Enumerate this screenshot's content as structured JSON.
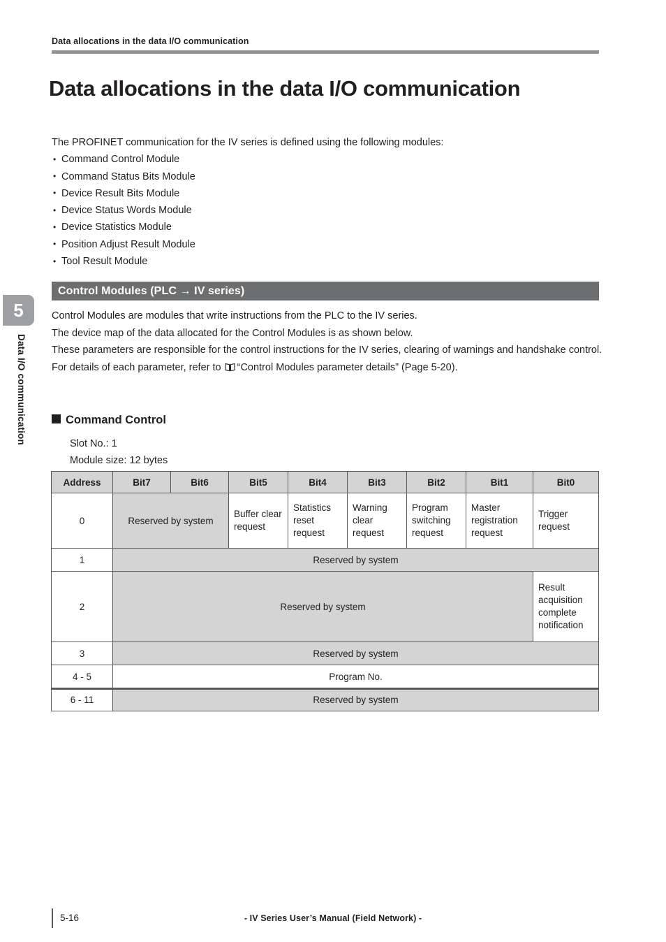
{
  "running_header": "Data allocations in the data I/O communication",
  "page_title": "Data allocations in the data I/O communication",
  "intro": {
    "lead": "The PROFINET communication for the IV series is defined using the following modules:",
    "bullets": [
      "Command Control Module",
      "Command Status Bits Module",
      "Device Result Bits Module",
      "Device Status Words Module",
      "Device Statistics Module",
      "Position Adjust Result Module",
      "Tool Result Module"
    ]
  },
  "section": {
    "band_title": "Control Modules (PLC → IV series)",
    "band_color": "#6d6e70",
    "paragraphs": [
      "Control Modules are modules that write instructions from the PLC to the IV series.",
      "The device map of the data allocated for the Control Modules is as shown below.",
      "These parameters are responsible for the control instructions for the IV series, clearing of warnings and handshake control."
    ],
    "reference": {
      "prefix": "For details of each parameter, refer to ",
      "icon": "book-icon",
      "text": "“Control Modules parameter details” (Page 5-20)."
    }
  },
  "subsection": {
    "title": "Command Control",
    "slot_no": "Slot No.: 1",
    "module_size": "Module size: 12 bytes"
  },
  "table": {
    "headers": [
      "Address",
      "Bit7",
      "Bit6",
      "Bit5",
      "Bit4",
      "Bit3",
      "Bit2",
      "Bit1",
      "Bit0"
    ],
    "rows": [
      {
        "address": "0",
        "cells": [
          "Reserved by system",
          "Buffer clear request",
          "Statistics reset request",
          "Warning clear request",
          "Program switching request",
          "Master registration request",
          "Trigger request"
        ]
      },
      {
        "address": "1",
        "cells": [
          "Reserved by system"
        ]
      },
      {
        "address": "2",
        "cells": [
          "Reserved by system",
          "Result acquisition complete notification"
        ]
      },
      {
        "address": "3",
        "cells": [
          "Reserved by system"
        ]
      },
      {
        "address": "4 - 5",
        "cells": [
          "Program No."
        ]
      },
      {
        "address": "6 - 11",
        "cells": [
          "Reserved by system"
        ]
      }
    ]
  },
  "chapter_tab": {
    "number": "5",
    "label": "Data I/O communication"
  },
  "footer": {
    "page_number": "5-16",
    "manual_line": "- IV Series User’s Manual (Field Network) -"
  }
}
